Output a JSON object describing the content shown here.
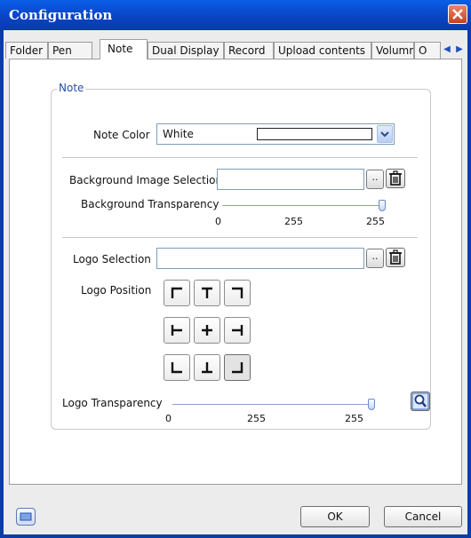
{
  "window": {
    "title": "Configuration"
  },
  "tabs": [
    {
      "label": "Folder"
    },
    {
      "label": "Pen"
    },
    {
      "label": "Note"
    },
    {
      "label": "Dual Display"
    },
    {
      "label": "Record"
    },
    {
      "label": "Upload contents"
    },
    {
      "label": "Volumn"
    },
    {
      "label": "O"
    }
  ],
  "active_tab": "Note",
  "note_group": {
    "legend": "Note",
    "note_color": {
      "label": "Note Color",
      "value": "White",
      "swatch_color": "#ffffff"
    },
    "background_image": {
      "label": "Background Image Selection",
      "value": "",
      "browse_label": ".."
    },
    "background_transparency": {
      "label": "Background Transparency",
      "min": "0",
      "mid": "255",
      "max": "255",
      "value_fraction": 1.0
    },
    "logo_selection": {
      "label": "Logo Selection",
      "value": "",
      "browse_label": ".."
    },
    "logo_position": {
      "label": "Logo Position",
      "selected": "bottom-right"
    },
    "logo_transparency": {
      "label": "Logo Transparency",
      "min": "0",
      "mid": "255",
      "max": "255",
      "value_fraction": 1.0
    }
  },
  "footer": {
    "ok_label": "OK",
    "cancel_label": "Cancel"
  },
  "colors": {
    "titlebar": "#0a44c3",
    "legend_text": "#2450a8",
    "close_button": "#c8401f"
  }
}
